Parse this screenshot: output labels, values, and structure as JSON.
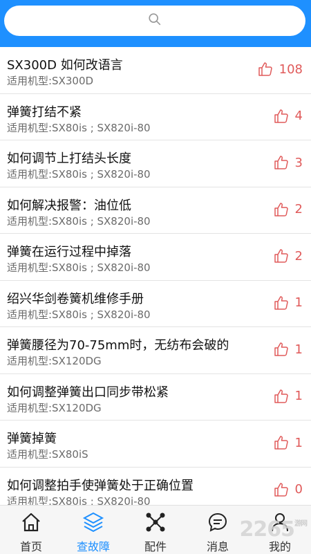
{
  "search": {
    "icon": "search-icon"
  },
  "items": [
    {
      "title": "SX300D 如何改语言",
      "model": "适用机型:SX300D",
      "likes": "108"
    },
    {
      "title": "弹簧打结不紧",
      "model": "适用机型:SX80is ; SX820i-80",
      "likes": "4"
    },
    {
      "title": "如何调节上打结头长度",
      "model": "适用机型:SX80is ; SX820i-80",
      "likes": "3"
    },
    {
      "title": "如何解决报警：油位低",
      "model": "适用机型:SX80is ; SX820i-80",
      "likes": "2"
    },
    {
      "title": "弹簧在运行过程中掉落",
      "model": "适用机型:SX80is ; SX820i-80",
      "likes": "2"
    },
    {
      "title": "绍兴华剑卷簧机维修手册",
      "model": "适用机型:SX80is ; SX820i-80",
      "likes": "1"
    },
    {
      "title": "弹簧腰径为70-75mm时，无纺布会破的",
      "model": "适用机型:SX120DG",
      "likes": "1"
    },
    {
      "title": "如何调整弹簧出口同步带松紧",
      "model": "适用机型:SX120DG",
      "likes": "1"
    },
    {
      "title": "弹簧掉簧",
      "model": "适用机型:SX80iS",
      "likes": "1"
    },
    {
      "title": "如何调整拍手使弹簧处于正确位置",
      "model": "适用机型:SX80is ; SX820i-80",
      "likes": "0"
    }
  ],
  "tabs": [
    {
      "label": "首页",
      "icon": "home-icon"
    },
    {
      "label": "查故障",
      "icon": "layers-icon"
    },
    {
      "label": "配件",
      "icon": "molecule-icon"
    },
    {
      "label": "消息",
      "icon": "chat-icon"
    },
    {
      "label": "我的",
      "icon": "user-icon"
    }
  ],
  "colors": {
    "primary": "#1e90ff",
    "like": "#e05a5a"
  },
  "watermark": {
    "main": "2265",
    "suffix": "游网"
  }
}
